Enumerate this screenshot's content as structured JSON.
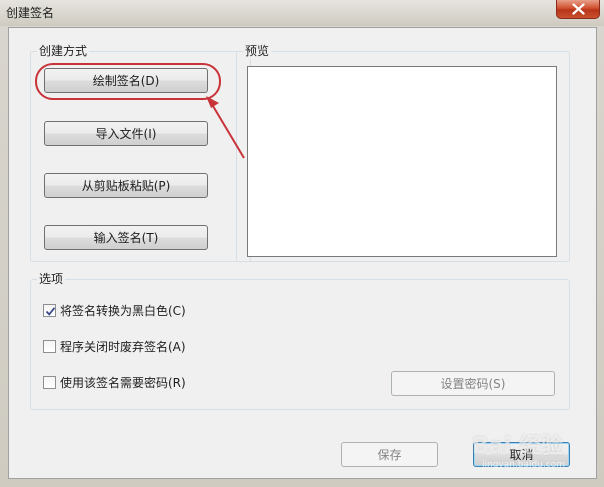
{
  "window": {
    "title": "创建签名"
  },
  "create_method": {
    "group_label": "创建方式",
    "buttons": [
      {
        "label": "绘制签名(D)"
      },
      {
        "label": "导入文件(I)"
      },
      {
        "label": "从剪贴板粘贴(P)"
      },
      {
        "label": "输入签名(T)"
      }
    ]
  },
  "preview": {
    "group_label": "预览"
  },
  "options": {
    "group_label": "选项",
    "checkboxes": [
      {
        "label": "将签名转换为黑白色(C)",
        "checked": true
      },
      {
        "label": "程序关闭时废弃签名(A)",
        "checked": false
      },
      {
        "label": "使用该签名需要密码(R)",
        "checked": false
      }
    ],
    "set_password_label": "设置密码(S)"
  },
  "footer": {
    "save_label": "保存",
    "cancel_label": "取消"
  },
  "watermark": {
    "text": "Bai 经验",
    "url": "jingyan.baidu.com"
  },
  "colors": {
    "highlight": "#c8333a"
  }
}
